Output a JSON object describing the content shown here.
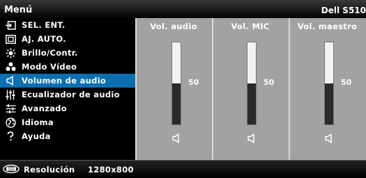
{
  "header": {
    "title": "Menú",
    "model": "Dell S510"
  },
  "menu": {
    "items": [
      {
        "label": "SEL. ENT.",
        "icon": "input-select-icon",
        "selected": false
      },
      {
        "label": "AJ. AUTO.",
        "icon": "auto-adjust-icon",
        "selected": false
      },
      {
        "label": "Brillo/Contr.",
        "icon": "brightness-icon",
        "selected": false
      },
      {
        "label": "Modo Vídeo",
        "icon": "video-mode-icon",
        "selected": false
      },
      {
        "label": "Volumen de audio",
        "icon": "speaker-icon",
        "selected": true
      },
      {
        "label": "Ecualizador de audio",
        "icon": "equalizer-icon",
        "selected": false
      },
      {
        "label": "Avanzado",
        "icon": "advanced-icon",
        "selected": false
      },
      {
        "label": "Idioma",
        "icon": "globe-icon",
        "selected": false
      },
      {
        "label": "Ayuda",
        "icon": "help-icon",
        "selected": false
      }
    ]
  },
  "volumes": [
    {
      "title": "Vol. audio",
      "value": "50",
      "level": 0.5
    },
    {
      "title": "Vol. MIC",
      "value": "50",
      "level": 0.5
    },
    {
      "title": "Vol. maestro",
      "value": "50",
      "level": 0.5
    }
  ],
  "status": {
    "resolution_label": "Resolución",
    "resolution_value": "1280x800",
    "icon": "resolution-icon"
  },
  "colors": {
    "selected": "#0b6fb1",
    "panel": "#a2a2a2",
    "header": "#111111"
  }
}
